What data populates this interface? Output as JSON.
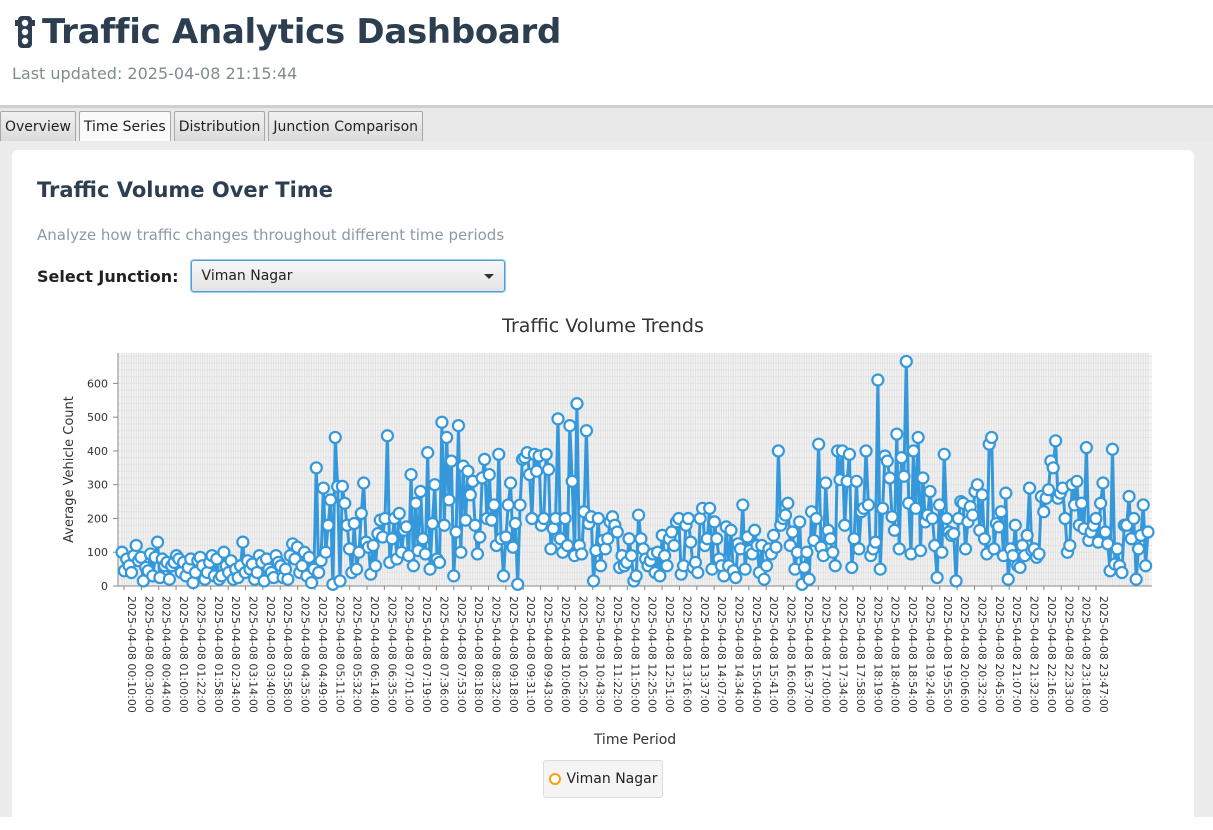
{
  "app": {
    "title": "Traffic Analytics Dashboard",
    "last_updated": "Last updated: 2025-04-08 21:15:44",
    "icon": "traffic-light-icon"
  },
  "tabs": [
    {
      "label": "Overview",
      "active": false
    },
    {
      "label": "Time Series",
      "active": true
    },
    {
      "label": "Distribution",
      "active": false
    },
    {
      "label": "Junction Comparison",
      "active": false
    }
  ],
  "panel": {
    "heading": "Traffic Volume Over Time",
    "subtitle": "Analyze how traffic changes throughout different time periods",
    "select_label": "Select Junction:",
    "selected_junction": "Viman Nagar"
  },
  "colors": {
    "line": "#3498db",
    "legend_marker": "#f3a20f",
    "title": "#2c3e50"
  },
  "chart_data": {
    "type": "line",
    "title": "Traffic Volume Trends",
    "xlabel": "Time Period",
    "ylabel": "Average Vehicle Count",
    "ylim": [
      0,
      690
    ],
    "yticks": [
      0,
      100,
      200,
      300,
      400,
      500,
      600
    ],
    "grid": true,
    "legend": "bottom-center",
    "x_tick_labels": [
      "2025-04-08 00:10:00",
      "2025-04-08 00:30:00",
      "2025-04-08 00:44:00",
      "2025-04-08 01:00:00",
      "2025-04-08 01:22:00",
      "2025-04-08 01:58:00",
      "2025-04-08 02:34:00",
      "2025-04-08 03:14:00",
      "2025-04-08 03:40:00",
      "2025-04-08 03:58:00",
      "2025-04-08 04:35:00",
      "2025-04-08 04:49:00",
      "2025-04-08 05:11:00",
      "2025-04-08 05:32:00",
      "2025-04-08 06:14:00",
      "2025-04-08 06:35:00",
      "2025-04-08 07:01:00",
      "2025-04-08 07:19:00",
      "2025-04-08 07:36:00",
      "2025-04-08 07:53:00",
      "2025-04-08 08:18:00",
      "2025-04-08 08:32:00",
      "2025-04-08 09:18:00",
      "2025-04-08 09:31:00",
      "2025-04-08 09:43:00",
      "2025-04-08 10:06:00",
      "2025-04-08 10:25:00",
      "2025-04-08 10:43:00",
      "2025-04-08 11:22:00",
      "2025-04-08 11:50:00",
      "2025-04-08 12:25:00",
      "2025-04-08 12:51:00",
      "2025-04-08 13:16:00",
      "2025-04-08 13:37:00",
      "2025-04-08 14:07:00",
      "2025-04-08 14:34:00",
      "2025-04-08 15:04:00",
      "2025-04-08 15:41:00",
      "2025-04-08 16:06:00",
      "2025-04-08 16:37:00",
      "2025-04-08 17:00:00",
      "2025-04-08 17:34:00",
      "2025-04-08 17:58:00",
      "2025-04-08 18:19:00",
      "2025-04-08 18:40:00",
      "2025-04-08 18:54:00",
      "2025-04-08 19:24:00",
      "2025-04-08 19:55:00",
      "2025-04-08 20:06:00",
      "2025-04-08 20:32:00",
      "2025-04-08 20:45:00",
      "2025-04-08 21:07:00",
      "2025-04-08 21:32:00",
      "2025-04-08 22:16:00",
      "2025-04-08 22:33:00",
      "2025-04-08 23:18:00",
      "2025-04-08 23:47:00"
    ],
    "series": [
      {
        "name": "Viman Nagar",
        "values": [
          100,
          45,
          80,
          60,
          40,
          90,
          120,
          75,
          85,
          15,
          55,
          45,
          95,
          30,
          85,
          130,
          25,
          80,
          60,
          70,
          20,
          60,
          70,
          90,
          80,
          40,
          70,
          30,
          55,
          80,
          10,
          40,
          75,
          85,
          60,
          20,
          40,
          70,
          90,
          30,
          80,
          20,
          30,
          100,
          60,
          40,
          75,
          20,
          50,
          25,
          60,
          130,
          40,
          75,
          50,
          65,
          20,
          40,
          90,
          70,
          15,
          80,
          50,
          40,
          25,
          90,
          70,
          60,
          25,
          50,
          20,
          90,
          125,
          80,
          115,
          40,
          60,
          100,
          30,
          85,
          10,
          50,
          350,
          40,
          75,
          290,
          100,
          180,
          255,
          5,
          440,
          295,
          15,
          295,
          245,
          180,
          110,
          40,
          185,
          50,
          100,
          215,
          305,
          130,
          115,
          35,
          120,
          60,
          155,
          195,
          145,
          200,
          445,
          70,
          140,
          200,
          80,
          215,
          100,
          165,
          175,
          90,
          330,
          60,
          245,
          105,
          280,
          140,
          95,
          395,
          50,
          185,
          300,
          80,
          70,
          485,
          180,
          440,
          255,
          370,
          30,
          160,
          475,
          100,
          355,
          195,
          340,
          270,
          310,
          180,
          95,
          145,
          320,
          375,
          200,
          330,
          195,
          240,
          120,
          390,
          140,
          30,
          145,
          240,
          305,
          115,
          185,
          5,
          240,
          375,
          380,
          395,
          330,
          200,
          390,
          340,
          385,
          180,
          200,
          390,
          345,
          110,
          170,
          200,
          495,
          140,
          100,
          200,
          120,
          475,
          310,
          90,
          540,
          120,
          95,
          220,
          460,
          185,
          205,
          15,
          105,
          200,
          60,
          135,
          110,
          140,
          190,
          205,
          180,
          160,
          55,
          90,
          60,
          70,
          140,
          90,
          15,
          30,
          210,
          140,
          110,
          80,
          60,
          75,
          95,
          40,
          100,
          30,
          150,
          90,
          60,
          140,
          160,
          120,
          190,
          200,
          35,
          60,
          180,
          200,
          130,
          55,
          70,
          40,
          200,
          230,
          120,
          140,
          230,
          50,
          190,
          140,
          80,
          60,
          30,
          175,
          60,
          165,
          45,
          25,
          125,
          110,
          240,
          50,
          145,
          105,
          95,
          165,
          120,
          40,
          120,
          20,
          60,
          110,
          95,
          150,
          115,
          400,
          180,
          200,
          210,
          245,
          120,
          160,
          50,
          100,
          190,
          5,
          55,
          100,
          20,
          220,
          135,
          200,
          420,
          115,
          90,
          305,
          165,
          140,
          100,
          60,
          400,
          315,
          400,
          180,
          310,
          390,
          55,
          140,
          310,
          110,
          220,
          230,
          400,
          240,
          90,
          110,
          130,
          610,
          50,
          230,
          385,
          370,
          320,
          205,
          165,
          450,
          110,
          380,
          325,
          665,
          245,
          95,
          400,
          230,
          440,
          105,
          320,
          190,
          210,
          280,
          200,
          120,
          25,
          240,
          100,
          390,
          200,
          160,
          150,
          155,
          15,
          200,
          250,
          245,
          110,
          190,
          235,
          210,
          280,
          300,
          165,
          270,
          140,
          95,
          420,
          440,
          110,
          185,
          175,
          220,
          90,
          275,
          20,
          110,
          90,
          180,
          60,
          55,
          120,
          90,
          150,
          290,
          105,
          110,
          85,
          95,
          265,
          220,
          260,
          285,
          370,
          350,
          430,
          260,
          275,
          290,
          200,
          100,
          120,
          300,
          240,
          310,
          180,
          245,
          170,
          410,
          135,
          160,
          180,
          200,
          130,
          245,
          305,
          160,
          125,
          45,
          405,
          65,
          110,
          60,
          40,
          180,
          180,
          265,
          140,
          200,
          20,
          110,
          150,
          240,
          60,
          160
        ]
      }
    ]
  }
}
